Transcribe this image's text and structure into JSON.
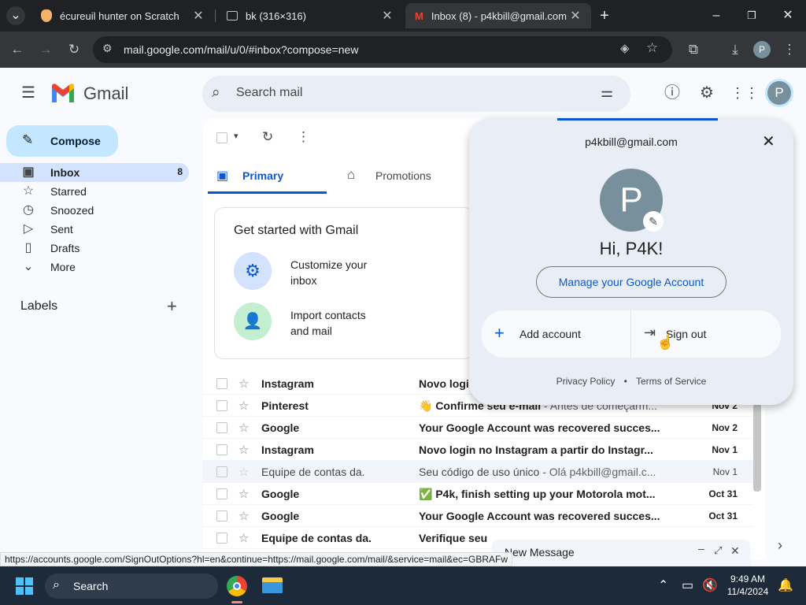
{
  "browser": {
    "tabs": [
      {
        "title": "écureuil hunter on Scratch"
      },
      {
        "title": "bk (316×316)"
      },
      {
        "title": "Inbox (8) - p4kbill@gmail.com"
      }
    ],
    "url": "mail.google.com/mail/u/0/#inbox?compose=new",
    "status_url": "https://accounts.google.com/SignOutOptions?hl=en&continue=https://mail.google.com/mail/&service=mail&ec=GBRAFw"
  },
  "gmail": {
    "logo": "Gmail",
    "search_placeholder": "Search mail",
    "avatar_letter": "P"
  },
  "sidebar": {
    "compose_label": "Compose",
    "items": [
      {
        "label": "Inbox",
        "count": "8"
      },
      {
        "label": "Starred",
        "count": ""
      },
      {
        "label": "Snoozed",
        "count": ""
      },
      {
        "label": "Sent",
        "count": ""
      },
      {
        "label": "Drafts",
        "count": ""
      },
      {
        "label": "More",
        "count": ""
      }
    ],
    "labels_heading": "Labels"
  },
  "main": {
    "tabs": [
      {
        "label": "Primary"
      },
      {
        "label": "Promotions"
      }
    ],
    "get_started": {
      "title": "Get started with Gmail",
      "items": [
        {
          "label": "Customize your inbox"
        },
        {
          "label": "Import contacts and mail"
        }
      ]
    },
    "emails": [
      {
        "sender": "Instagram",
        "subject": "Novo logi",
        "date": "",
        "unread": true
      },
      {
        "sender": "Pinterest",
        "subject": "👋 Confirme seu e-mail",
        "snippet": " - Antes de começarm...",
        "date": "Nov 2",
        "unread": true
      },
      {
        "sender": "Google",
        "subject": "Your Google Account was recovered succes...",
        "date": "Nov 2",
        "unread": true
      },
      {
        "sender": "Instagram",
        "subject": "Novo login no Instagram a partir do Instagr...",
        "date": "Nov 1",
        "unread": true
      },
      {
        "sender": "Equipe de contas da.",
        "subject": "Seu código de uso único",
        "snippet": " - Olá p4kbill@gmail.c...",
        "date": "Nov 1",
        "unread": false
      },
      {
        "sender": "Google",
        "subject": "✅ P4k, finish setting up your Motorola mot...",
        "date": "Oct 31",
        "unread": true
      },
      {
        "sender": "Google",
        "subject": "Your Google Account was recovered succes...",
        "date": "Oct 31",
        "unread": true
      },
      {
        "sender": "Equipe de contas da.",
        "subject": "Verifique seu",
        "date": "",
        "unread": true
      }
    ]
  },
  "account_popup": {
    "email": "p4kbill@gmail.com",
    "avatar_letter": "P",
    "greeting": "Hi, P4K!",
    "manage_label": "Manage your Google Account",
    "add_account_label": "Add account",
    "sign_out_label": "Sign out",
    "privacy_label": "Privacy Policy",
    "separator": "•",
    "terms_label": "Terms of Service"
  },
  "new_message": {
    "title": "New Message"
  },
  "taskbar": {
    "search_label": "Search",
    "time": "9:49 AM",
    "date": "11/4/2024"
  },
  "colors": {
    "compose_bg": "#c2e7ff",
    "active_nav_bg": "#d3e3fd",
    "primary_blue": "#0b57d0",
    "popup_bg": "#e9eef6"
  }
}
